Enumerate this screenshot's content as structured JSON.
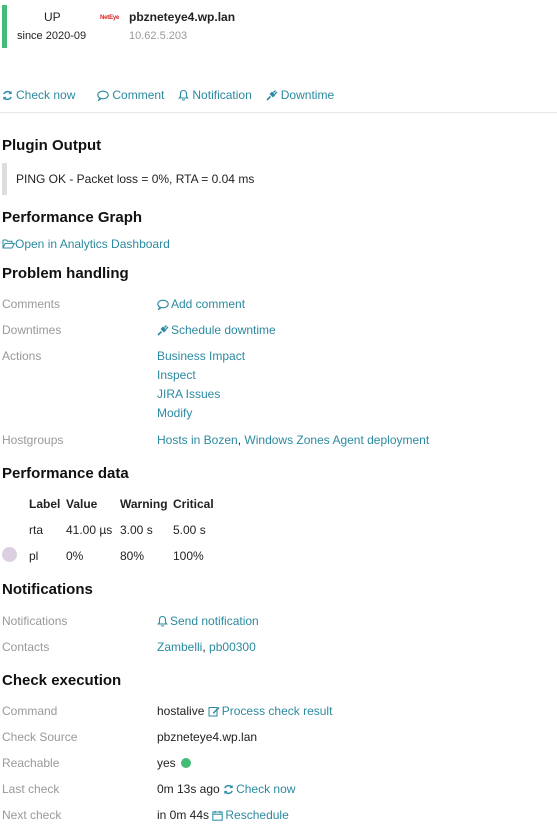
{
  "host": {
    "state": "UP",
    "since": "since 2020-09",
    "logo_text": "NetEye",
    "name": "pbzneteye4.wp.lan",
    "address": "10.62.5.203",
    "colors": {
      "state_up": "#44bb77",
      "link": "#2b8aa0"
    }
  },
  "quick_actions": [
    {
      "label": "Check now",
      "icon": "refresh-icon"
    },
    {
      "label": "Comment",
      "icon": "comment-icon"
    },
    {
      "label": "Notification",
      "icon": "bell-icon"
    },
    {
      "label": "Downtime",
      "icon": "plug-icon"
    }
  ],
  "plugin_output": {
    "heading": "Plugin Output",
    "text": "PING OK - Packet loss = 0%, RTA = 0.04 ms"
  },
  "performance_graph": {
    "heading": "Performance Graph",
    "link": "Open in Analytics Dashboard"
  },
  "problem_handling": {
    "heading": "Problem handling",
    "comments_label": "Comments",
    "add_comment": "Add comment",
    "downtimes_label": "Downtimes",
    "schedule_downtime": "Schedule downtime",
    "actions_label": "Actions",
    "actions": [
      "Business Impact",
      "Inspect",
      "JIRA Issues",
      "Modify"
    ],
    "hostgroups_label": "Hostgroups",
    "hostgroups": [
      "Hosts in Bozen",
      "Windows Zones Agent deployment"
    ],
    "separator": ","
  },
  "performance_data": {
    "heading": "Performance data",
    "columns": [
      "Label",
      "Value",
      "Warning",
      "Critical"
    ],
    "rows": [
      {
        "label": "rta",
        "value": "41.00 µs",
        "warning": "3.00 s",
        "critical": "5.00 s"
      },
      {
        "label": "pl",
        "value": "0%",
        "warning": "80%",
        "critical": "100%"
      }
    ]
  },
  "notifications": {
    "heading": "Notifications",
    "notifications_label": "Notifications",
    "send_notification": "Send notification",
    "contacts_label": "Contacts",
    "contacts": [
      "Zambelli",
      "pb00300"
    ]
  },
  "check_execution": {
    "heading": "Check execution",
    "command_label": "Command",
    "command": "hostalive",
    "process_check_result": "Process check result",
    "check_source_label": "Check Source",
    "check_source": "pbzneteye4.wp.lan",
    "reachable_label": "Reachable",
    "reachable": "yes",
    "last_check_label": "Last check",
    "last_check": "0m 13s ago",
    "check_now": "Check now",
    "next_check_label": "Next check",
    "next_check": "in 0m 44s",
    "reschedule": "Reschedule"
  }
}
